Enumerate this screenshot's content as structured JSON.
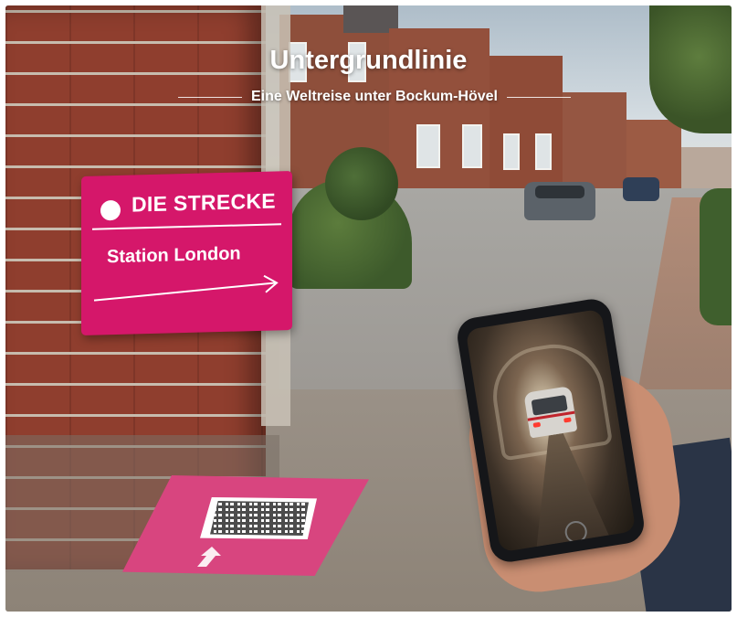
{
  "header": {
    "title": "Untergrundlinie",
    "subtitle": "Eine Weltreise unter Bockum-Hövel"
  },
  "sign": {
    "title": "DIE STRECKE",
    "station": "Station London",
    "color": "#d5176a"
  },
  "floor_mat": {
    "has_qr_code": true,
    "arrow": "arrow-up-icon",
    "color": "#d8457f"
  },
  "phone": {
    "screen_content": "subway train in tunnel"
  },
  "colors": {
    "accent": "#d5176a",
    "text": "#ffffff"
  }
}
